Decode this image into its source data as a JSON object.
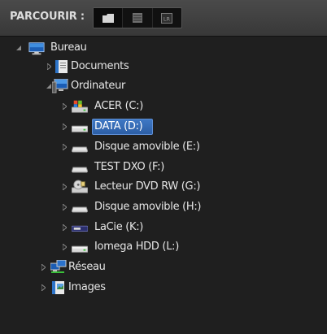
{
  "header": {
    "title": "PARCOURIR :",
    "buttons": [
      {
        "icon": "folder-icon",
        "active": true
      },
      {
        "icon": "list-icon",
        "active": false
      },
      {
        "icon": "lightroom-icon",
        "label": "LR",
        "active": false
      }
    ]
  },
  "tree": {
    "root": {
      "label": "Bureau",
      "icon": "desktop-icon",
      "expanded": true
    },
    "items": [
      {
        "label": "Documents",
        "icon": "documents-icon",
        "expanded": false
      },
      {
        "label": "Ordinateur",
        "icon": "computer-icon",
        "expanded": true
      },
      {
        "label": "ACER (C:)",
        "icon": "system-drive-icon"
      },
      {
        "label": "DATA (D:)",
        "icon": "drive-icon",
        "selected": true
      },
      {
        "label": "Disque amovible (E:)",
        "icon": "removable-drive-icon"
      },
      {
        "label": "TEST DXO (F:)",
        "icon": "drive-icon"
      },
      {
        "label": "Lecteur DVD RW (G:)",
        "icon": "dvd-drive-icon"
      },
      {
        "label": "Disque amovible (H:)",
        "icon": "removable-drive-icon"
      },
      {
        "label": "LaCie (K:)",
        "icon": "lacie-drive-icon"
      },
      {
        "label": "Iomega HDD (L:)",
        "icon": "drive-icon"
      },
      {
        "label": "Réseau",
        "icon": "network-icon",
        "expanded": false
      },
      {
        "label": "Images",
        "icon": "images-icon",
        "expanded": false
      }
    ]
  },
  "colors": {
    "selection": "#3a6fb8",
    "text": "#e6e6e6",
    "background": "#1f1f1f"
  }
}
